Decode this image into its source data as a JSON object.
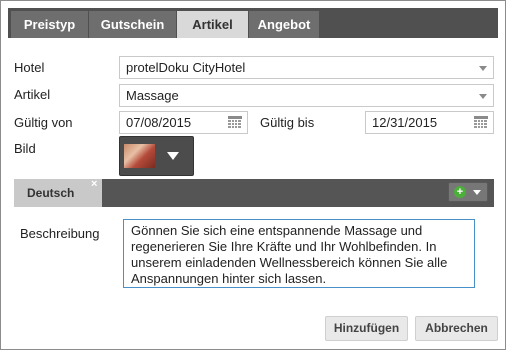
{
  "tabs": [
    "Preistyp",
    "Gutschein",
    "Artikel",
    "Angebot"
  ],
  "active_tab": "Artikel",
  "form": {
    "hotel_label": "Hotel",
    "hotel_value": "protelDoku CityHotel",
    "artikel_label": "Artikel",
    "artikel_value": "Massage",
    "gueltig_von_label": "Gültig von",
    "gueltig_von_value": "07/08/2015",
    "gueltig_bis_label": "Gültig bis",
    "gueltig_bis_value": "12/31/2015",
    "bild_label": "Bild"
  },
  "language": {
    "tab_label": "Deutsch",
    "close_glyph": "×",
    "add_glyph": "+"
  },
  "description": {
    "label": "Beschreibung",
    "text": "Gönnen Sie sich eine entspannende Massage und regenerieren Sie Ihre Kräfte und Ihr Wohlbefinden. In unserem einladenden Wellnessbereich können Sie alle Anspannungen hinter sich lassen."
  },
  "buttons": {
    "add": "Hinzufügen",
    "cancel": "Abbrechen"
  },
  "colors": {
    "tabstrip_bg": "#505050",
    "active_tab_bg": "#d9d9d9",
    "add_icon": "#4caf3a",
    "textarea_focus_border": "#4a90c8"
  }
}
